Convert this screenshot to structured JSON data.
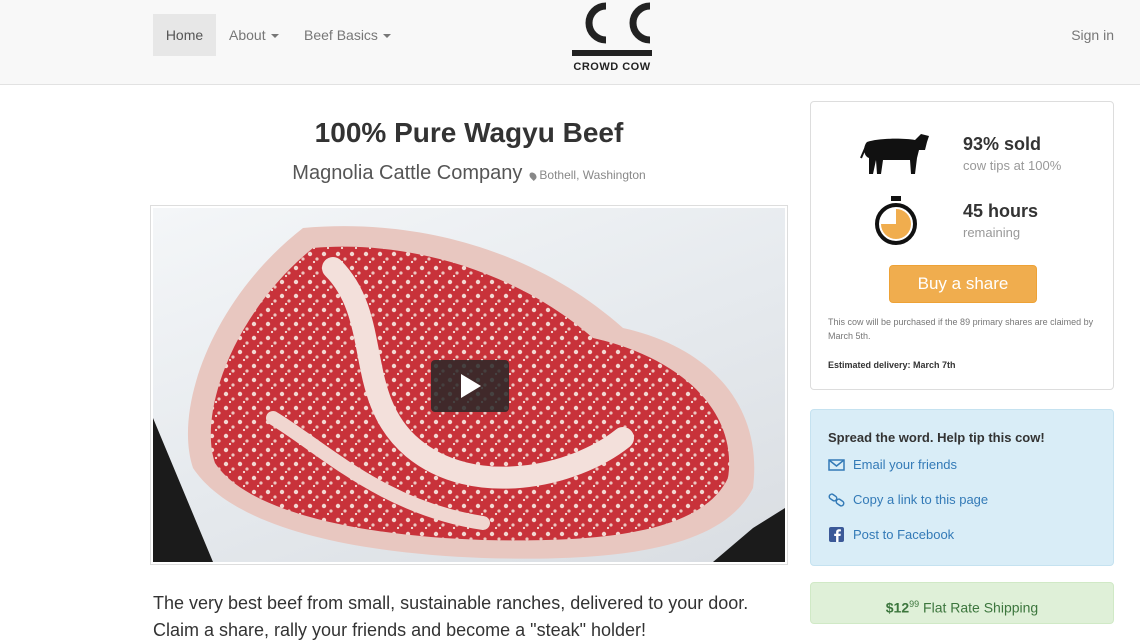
{
  "nav": {
    "home": "Home",
    "about": "About",
    "beef_basics": "Beef Basics",
    "sign_in": "Sign in",
    "logo_text": "CROWD COW"
  },
  "product": {
    "title": "100% Pure Wagyu Beef",
    "farm": "Magnolia Cattle Company",
    "location": "Bothell, Washington"
  },
  "tagline": "The very best beef from small, sustainable ranches, delivered to your door. Claim a share, rally your friends and become a \"steak\" holder!",
  "status": {
    "sold": "93% sold",
    "tips": "cow tips at 100%",
    "hours": "45 hours",
    "remaining": "remaining",
    "progress": 0.93,
    "buy_label": "Buy a share",
    "fine_print": "This cow will be purchased if the 89 primary shares are claimed by March 5th.",
    "delivery": "Estimated delivery: March 7th"
  },
  "share": {
    "heading": "Spread the word. Help tip this cow!",
    "email": "Email your friends",
    "copy_link": "Copy a link to this page",
    "facebook": "Post to Facebook"
  },
  "shipping": {
    "dollars": "$12",
    "cents": "99",
    "label": " Flat Rate Shipping"
  },
  "colors": {
    "accent": "#f0ad4e",
    "link": "#337ab7",
    "share_bg": "#d9edf7",
    "shipping_bg": "#dff0d8",
    "shipping_text": "#3c763d"
  },
  "icons": {
    "cow": "cow-icon",
    "timer": "stopwatch-icon",
    "email": "envelope-icon",
    "link": "chain-link-icon",
    "facebook": "facebook-icon",
    "play": "play-icon",
    "pin": "map-pin-icon"
  }
}
